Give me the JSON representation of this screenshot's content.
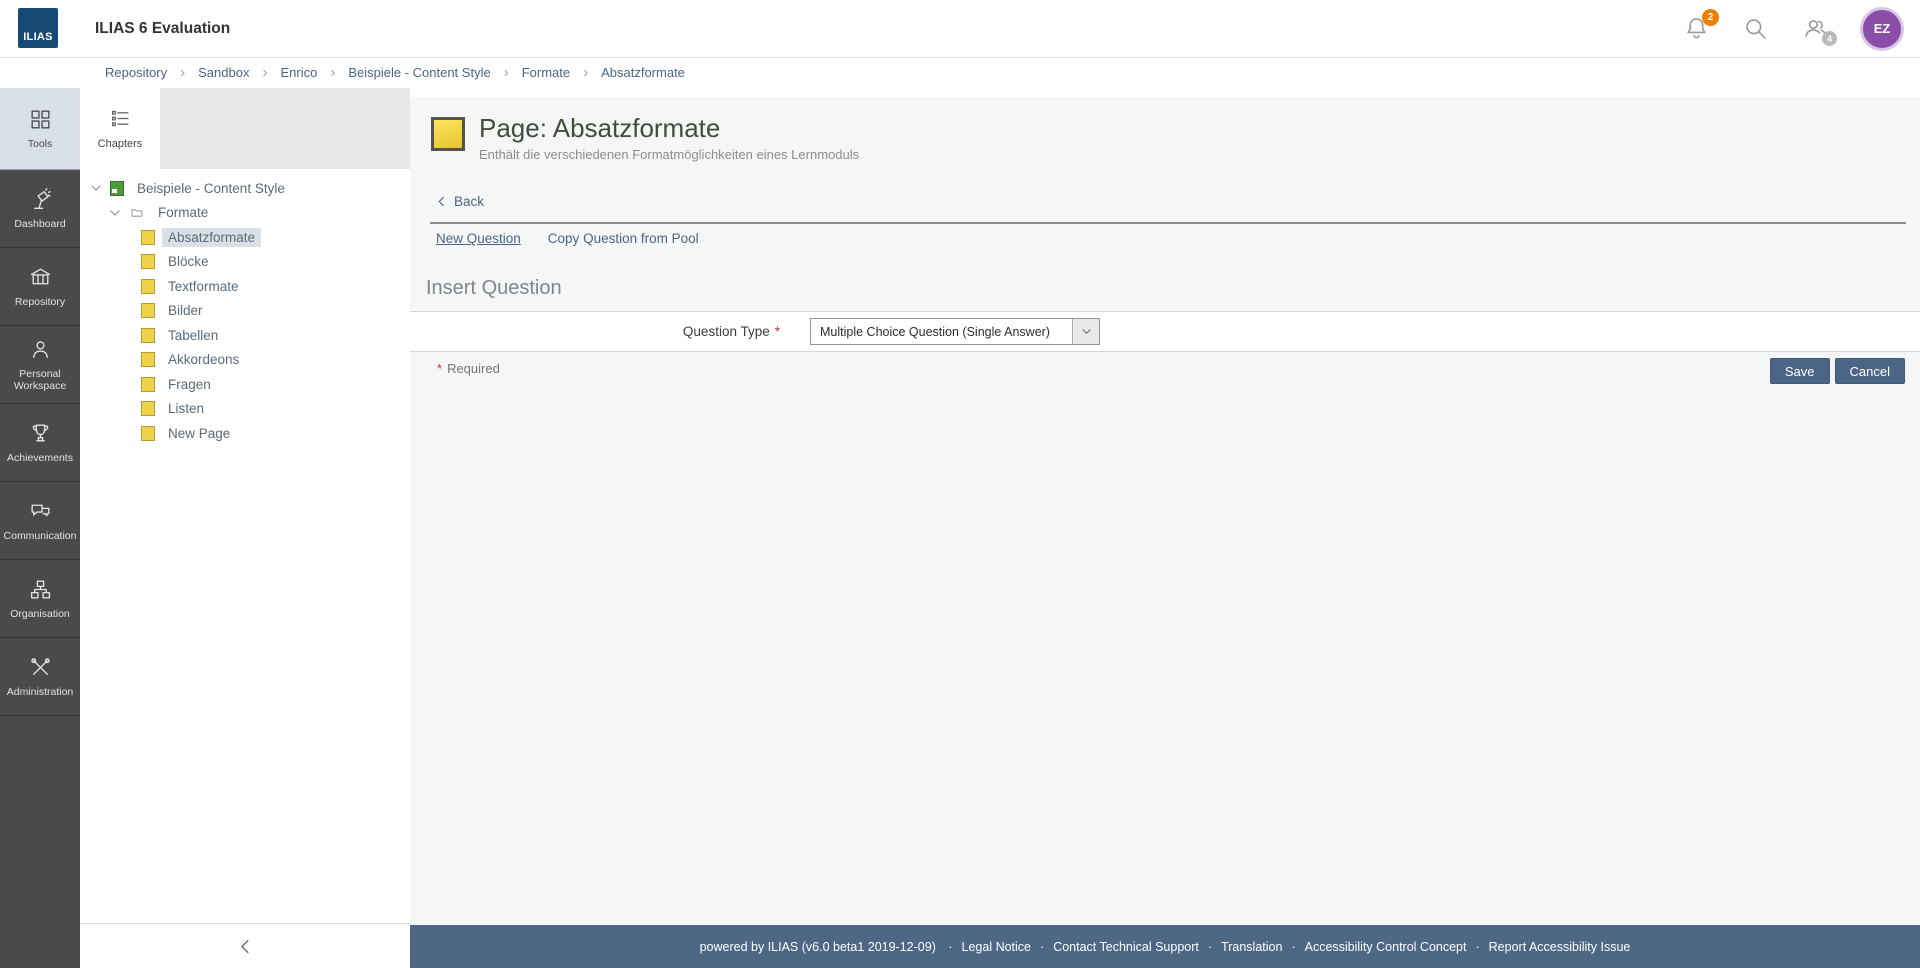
{
  "header": {
    "logo_text": "ILIAS",
    "title": "ILIAS 6 Evaluation",
    "notification_count": "2",
    "online_count": "4",
    "avatar_initials": "EZ"
  },
  "breadcrumb": {
    "items": [
      "Repository",
      "Sandbox",
      "Enrico",
      "Beispiele - Content Style",
      "Formate",
      "Absatzformate"
    ]
  },
  "sidebar": {
    "items": [
      {
        "label": "Tools",
        "icon": "tools-grid-icon",
        "active": true
      },
      {
        "label": "Dashboard",
        "icon": "dashboard-icon",
        "active": false
      },
      {
        "label": "Repository",
        "icon": "repository-icon",
        "active": false
      },
      {
        "label": "Personal Workspace",
        "icon": "personal-workspace-icon",
        "active": false
      },
      {
        "label": "Achievements",
        "icon": "achievements-icon",
        "active": false
      },
      {
        "label": "Communication",
        "icon": "communication-icon",
        "active": false
      },
      {
        "label": "Organisation",
        "icon": "organisation-icon",
        "active": false
      },
      {
        "label": "Administration",
        "icon": "administration-icon",
        "active": false
      }
    ]
  },
  "slate": {
    "tab_label": "Chapters",
    "tree": [
      {
        "label": "Beispiele - Content Style",
        "depth": 0,
        "icon": "learning-module-icon",
        "expandable": true,
        "selected": false
      },
      {
        "label": "Formate",
        "depth": 1,
        "icon": "folder-icon",
        "expandable": true,
        "selected": false
      },
      {
        "label": "Absatzformate",
        "depth": 2,
        "icon": "page-icon",
        "expandable": false,
        "selected": true
      },
      {
        "label": "Blöcke",
        "depth": 2,
        "icon": "page-icon",
        "expandable": false,
        "selected": false
      },
      {
        "label": "Textformate",
        "depth": 2,
        "icon": "page-icon",
        "expandable": false,
        "selected": false
      },
      {
        "label": "Bilder",
        "depth": 2,
        "icon": "page-icon",
        "expandable": false,
        "selected": false
      },
      {
        "label": "Tabellen",
        "depth": 2,
        "icon": "page-icon",
        "expandable": false,
        "selected": false
      },
      {
        "label": "Akkordeons",
        "depth": 2,
        "icon": "page-icon",
        "expandable": false,
        "selected": false
      },
      {
        "label": "Fragen",
        "depth": 2,
        "icon": "page-icon",
        "expandable": false,
        "selected": false
      },
      {
        "label": "Listen",
        "depth": 2,
        "icon": "page-icon",
        "expandable": false,
        "selected": false
      },
      {
        "label": "New Page",
        "depth": 2,
        "icon": "page-icon",
        "expandable": false,
        "selected": false
      }
    ]
  },
  "content": {
    "page_title": "Page: Absatzformate",
    "page_subtitle": "Enthält die verschiedenen Formatmöglichkeiten eines Lernmoduls",
    "back_label": "Back",
    "tabs": [
      {
        "label": "New Question",
        "active": true
      },
      {
        "label": "Copy Question from Pool",
        "active": false
      }
    ],
    "form": {
      "section_title": "Insert Question",
      "question_type_label": "Question Type",
      "required_marker": "*",
      "select_value": "Multiple Choice Question (Single Answer)",
      "required_note": "Required",
      "save_label": "Save",
      "cancel_label": "Cancel"
    }
  },
  "footer": {
    "powered_by": "powered by ILIAS (v6.0 beta1 2019-12-09)",
    "separator": "·",
    "links": [
      "Legal Notice",
      "Contact Technical Support",
      "Translation",
      "Accessibility Control Concept",
      "Report Accessibility Issue"
    ]
  },
  "colors": {
    "primary_slate": "#4c6586",
    "footer_bg": "#4d6785",
    "sidebar_bg": "#4b4949",
    "sidebar_active_bg": "#d9e0e9",
    "page_title_green": "#414e3a",
    "page_icon_yellow": "#f5d743",
    "tree_page_yellow": "#eed34a",
    "module_green": "#4e9a3c",
    "badge_orange": "#ee7f00",
    "badge_gray": "#b9b9b9",
    "avatar_purple": "#8c4da8",
    "selected_tree_bg": "#dbe0e6"
  }
}
